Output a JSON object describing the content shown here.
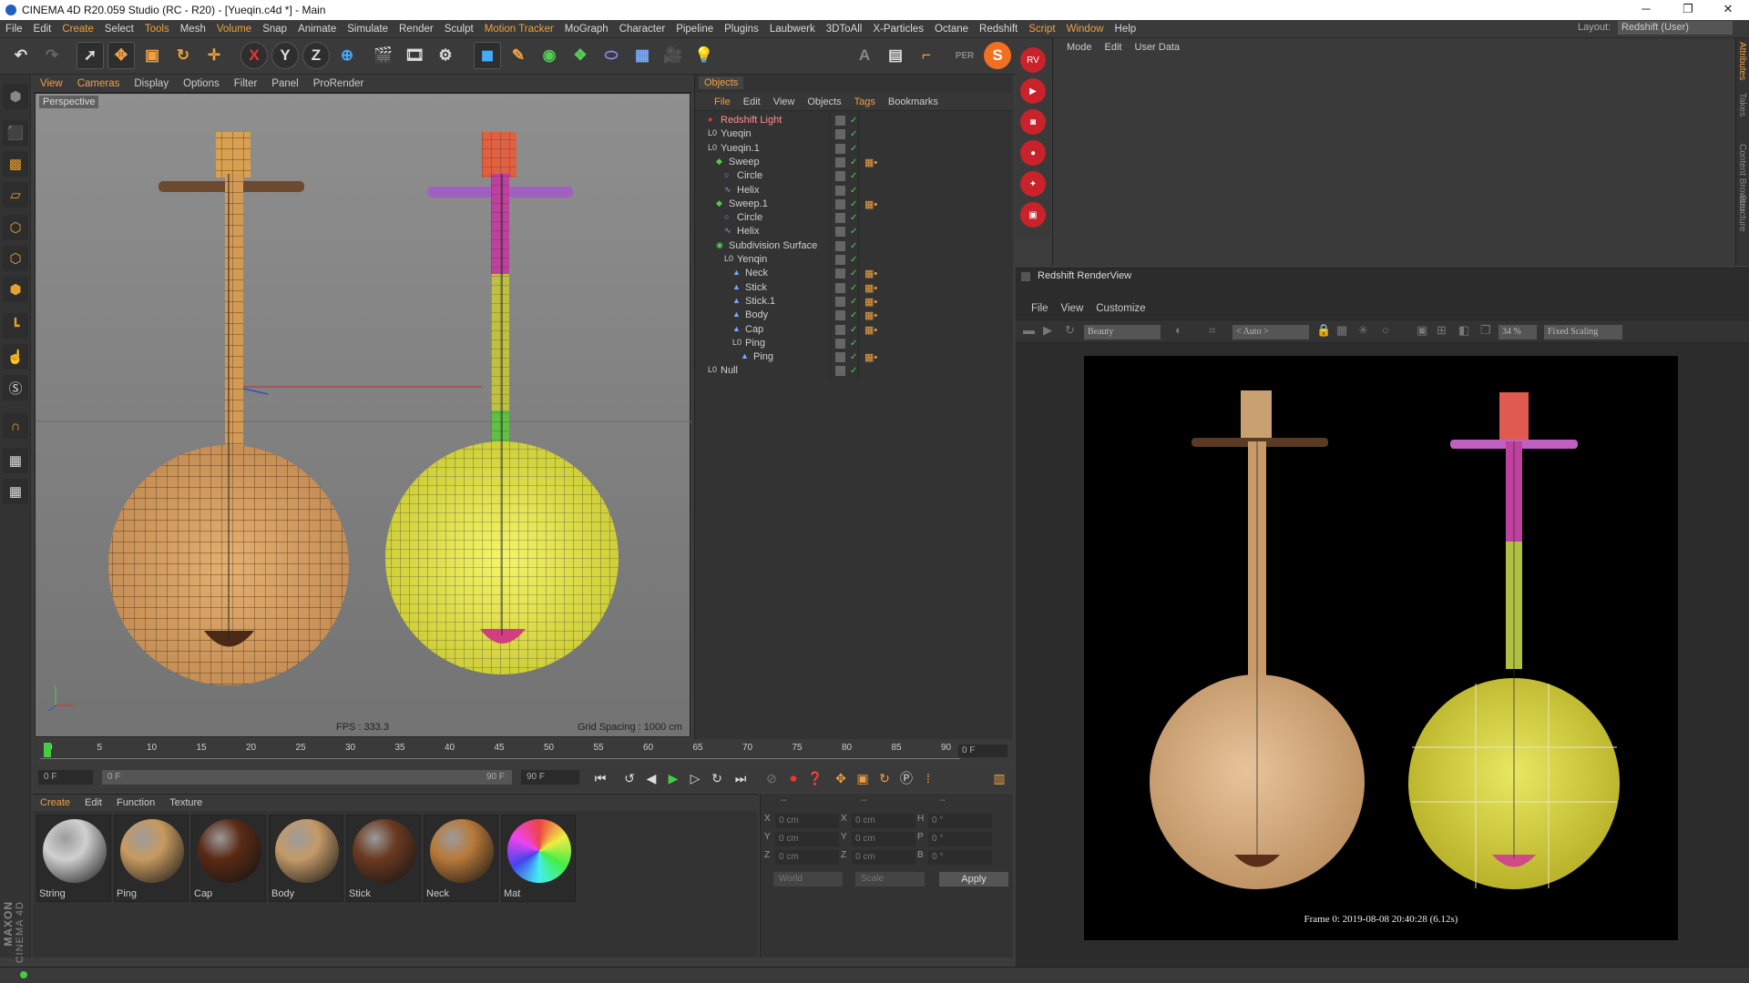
{
  "window": {
    "title": "CINEMA 4D R20.059 Studio (RC - R20) - [Yueqin.c4d *] - Main",
    "minimize": "─",
    "restore": "❐",
    "close": "✕"
  },
  "menubar": {
    "items": [
      "File",
      "Edit",
      "Create",
      "Select",
      "Tools",
      "Mesh",
      "Volume",
      "Snap",
      "Animate",
      "Simulate",
      "Render",
      "Sculpt",
      "Motion Tracker",
      "MoGraph",
      "Character",
      "Pipeline",
      "Plugins",
      "Laubwerk",
      "3DToAll",
      "X-Particles",
      "Octane",
      "Redshift",
      "Script",
      "Window",
      "Help"
    ],
    "highlighted": [
      "Create",
      "Tools",
      "Volume",
      "Motion Tracker",
      "Script",
      "Window"
    ],
    "layout_label": "Layout:",
    "layout_value": "Redshift (User)"
  },
  "toolbar": {
    "undo_icon": "undo-icon",
    "axis_x": "X",
    "axis_y": "Y",
    "axis_z": "Z",
    "s_badge": "S"
  },
  "viewport": {
    "menu": [
      "View",
      "Cameras",
      "Display",
      "Options",
      "Filter",
      "Panel",
      "ProRender"
    ],
    "highlighted": [
      "View",
      "Cameras"
    ],
    "label": "Perspective",
    "fps": "FPS : 333.3",
    "grid_spacing": "Grid Spacing : 1000 cm"
  },
  "objects": {
    "tab": "Objects",
    "menu": [
      "File",
      "Edit",
      "View",
      "Objects",
      "Tags",
      "Bookmarks"
    ],
    "highlighted": [
      "File",
      "Tags"
    ],
    "rows": [
      {
        "name": "Redshift Light",
        "indent": 0,
        "icon": "redshift-light-icon",
        "color": "#ff9090"
      },
      {
        "name": "Yueqin",
        "indent": 0,
        "icon": "null-icon"
      },
      {
        "name": "Yueqin.1",
        "indent": 0,
        "icon": "null-icon"
      },
      {
        "name": "Sweep",
        "indent": 1,
        "icon": "sweep-icon"
      },
      {
        "name": "Circle",
        "indent": 2,
        "icon": "circle-spline-icon"
      },
      {
        "name": "Helix",
        "indent": 2,
        "icon": "helix-spline-icon"
      },
      {
        "name": "Sweep.1",
        "indent": 1,
        "icon": "sweep-icon"
      },
      {
        "name": "Circle",
        "indent": 2,
        "icon": "circle-spline-icon"
      },
      {
        "name": "Helix",
        "indent": 2,
        "icon": "helix-spline-icon"
      },
      {
        "name": "Subdivision Surface",
        "indent": 1,
        "icon": "subdivision-icon"
      },
      {
        "name": "Yenqin",
        "indent": 2,
        "icon": "null-icon"
      },
      {
        "name": "Neck",
        "indent": 3,
        "icon": "polygon-icon"
      },
      {
        "name": "Stick",
        "indent": 3,
        "icon": "polygon-icon"
      },
      {
        "name": "Stick.1",
        "indent": 3,
        "icon": "polygon-icon"
      },
      {
        "name": "Body",
        "indent": 3,
        "icon": "polygon-icon"
      },
      {
        "name": "Cap",
        "indent": 3,
        "icon": "polygon-icon"
      },
      {
        "name": "Ping",
        "indent": 3,
        "icon": "null-icon"
      },
      {
        "name": "Ping",
        "indent": 4,
        "icon": "polygon-icon"
      },
      {
        "name": "Null",
        "indent": 0,
        "icon": "null-icon"
      }
    ]
  },
  "attributes": {
    "menu": [
      "Mode",
      "Edit",
      "User Data"
    ],
    "side_tabs": [
      "Attributes",
      "Takes",
      "Content Browser",
      "Structure"
    ]
  },
  "renderview": {
    "title": "Redshift RenderView",
    "menu": [
      "File",
      "View",
      "Customize"
    ],
    "aov": "Beauty",
    "region": "< Auto >",
    "zoom": "34 %",
    "scaling": "Fixed Scaling",
    "frame_info": "Frame 0:  2019-08-08  20:40:28  (6.12s)"
  },
  "timeline": {
    "ticks": [
      "0",
      "5",
      "10",
      "15",
      "20",
      "25",
      "30",
      "35",
      "40",
      "45",
      "50",
      "55",
      "60",
      "65",
      "70",
      "75",
      "80",
      "85",
      "90"
    ],
    "current_frame": "0 F",
    "start": "0 F",
    "range_start": "0 F",
    "range_end": "90 F",
    "end": "90 F"
  },
  "materials": {
    "menu": [
      "Create",
      "Edit",
      "Function",
      "Texture"
    ],
    "highlighted": [
      "Create"
    ],
    "items": [
      {
        "name": "String",
        "color": "#d0d0d0"
      },
      {
        "name": "Ping",
        "color": "#c79a60"
      },
      {
        "name": "Cap",
        "color": "#5a2a15"
      },
      {
        "name": "Body",
        "color": "#c49a68"
      },
      {
        "name": "Stick",
        "color": "#6a3a20"
      },
      {
        "name": "Neck",
        "color": "#b8793a"
      },
      {
        "name": "Mat",
        "color": "#a0c060"
      }
    ]
  },
  "coordinates": {
    "headers": [
      "--",
      "--",
      "--"
    ],
    "rows": [
      {
        "a": "X",
        "av": "0 cm",
        "b": "X",
        "bv": "0 cm",
        "c": "H",
        "cv": "0 °"
      },
      {
        "a": "Y",
        "av": "0 cm",
        "b": "Y",
        "bv": "0 cm",
        "c": "P",
        "cv": "0 °"
      },
      {
        "a": "Z",
        "av": "0 cm",
        "b": "Z",
        "bv": "0 cm",
        "c": "B",
        "cv": "0 °"
      }
    ],
    "space": "World",
    "mode": "Scale",
    "apply": "Apply"
  },
  "brand": {
    "line1": "MAXON",
    "line2": "CINEMA 4D"
  }
}
